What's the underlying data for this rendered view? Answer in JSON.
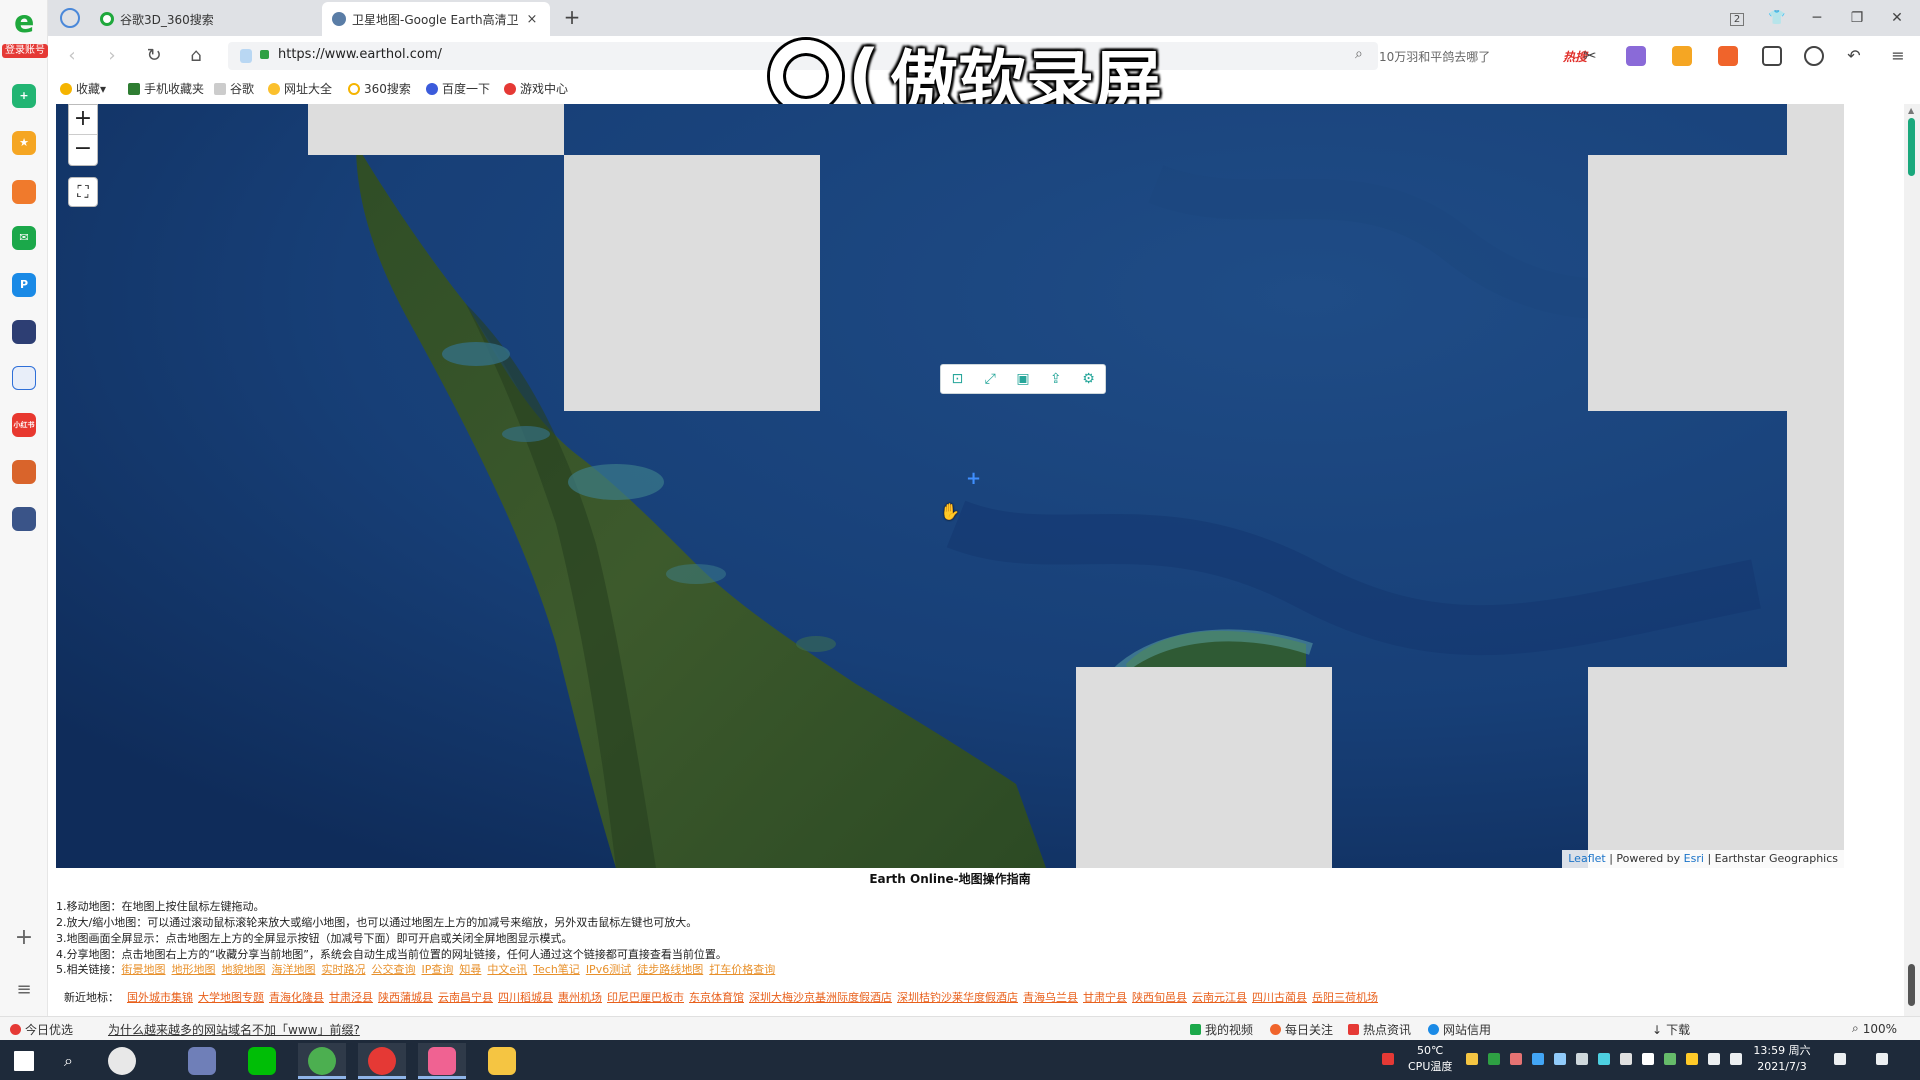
{
  "tabs": [
    {
      "title": "谷歌3D_360搜索"
    },
    {
      "title": "卫星地图-Google Earth高清卫"
    }
  ],
  "tab_close": "×",
  "new_tab": "+",
  "window": {
    "badge": "2"
  },
  "nav": {
    "back": "‹",
    "forward": "›",
    "reload": "↻",
    "home": "⌂"
  },
  "address": {
    "url": "https://www.earthol.com/"
  },
  "search": {
    "query": "10万羽和平鸽去哪了",
    "hot": "热搜"
  },
  "bookmarks": [
    "收藏",
    "手机收藏夹",
    "谷歌",
    "网址大全",
    "360搜索",
    "百度一下",
    "游戏中心"
  ],
  "watermark": {
    "text": "傲软录屏"
  },
  "sidebar": {
    "login_label": "登录账号",
    "items": [
      {
        "name": "plus",
        "color": "#22b573"
      },
      {
        "name": "star",
        "color": "#f5a623"
      },
      {
        "name": "weibo",
        "color": "#f07a2c"
      },
      {
        "name": "mail",
        "color": "#1ba84a"
      },
      {
        "name": "p-app",
        "color": "#1a8ae6",
        "label": "P"
      },
      {
        "name": "news",
        "color": "#2d3e73"
      },
      {
        "name": "doc",
        "color": "#2e6fd8"
      },
      {
        "name": "red-app",
        "color": "#e8382f",
        "label": "小红书"
      },
      {
        "name": "game1",
        "color": "#d9642b"
      },
      {
        "name": "game2",
        "color": "#3a5488"
      }
    ]
  },
  "map": {
    "zoom_in": "+",
    "zoom_out": "−",
    "fullscreen": "⛶",
    "tools": [
      "⊡",
      "⤢",
      "▣",
      "⇪",
      "⚙"
    ],
    "attribution": {
      "leaflet": "Leaflet",
      "powered": "| Powered by",
      "esri": "Esri",
      "earthstar": "| Earthstar Geographics"
    }
  },
  "guide": {
    "title": "Earth Online-地图操作指南",
    "lines": [
      "1.移动地图：在地图上按住鼠标左键拖动。",
      "2.放大/缩小地图：可以通过滚动鼠标滚轮来放大或缩小地图，也可以通过地图左上方的加减号来缩放，另外双击鼠标左键也可放大。",
      "3.地图画面全屏显示：点击地图左上方的全屏显示按钮（加减号下面）即可开启或关闭全屏地图显示模式。",
      "4.分享地图：点击地图右上方的“收藏分享当前地图”，系统会自动生成当前位置的网址链接，任何人通过这个链接都可直接查看当前位置。"
    ],
    "related_label": "5.相关链接：",
    "related_links": [
      "街景地图",
      "地形地图",
      "地貌地图",
      "海洋地图",
      "实时路况",
      "公交查询",
      "IP查询",
      "知尋",
      "中文e讯",
      "Tech笔记",
      "IPv6测试",
      "徒步路线地图",
      "打车价格查询"
    ],
    "nearby_label": "新近地标：",
    "nearby_links": [
      "国外城市集锦",
      "大学地图专题",
      "青海化隆县",
      "甘肃泾县",
      "陕西蒲城县",
      "云南昌宁县",
      "四川稻城县",
      "惠州机场",
      "印尼巴厘巴板市",
      "东京体育馆",
      "深圳大梅沙京基洲际度假酒店",
      "深圳桔钓沙莱华度假酒店",
      "青海乌兰县",
      "甘肃宁县",
      "陕西旬邑县",
      "云南元江县",
      "四川古蔺县",
      "岳阳三荷机场"
    ]
  },
  "statusbar": {
    "left": [
      "今日优选",
      "为什么越来越多的网站域名不加「www」前缀?"
    ],
    "right": [
      "我的视频",
      "每日关注",
      "热点资讯",
      "网站信用",
      "下载",
      "100%"
    ]
  },
  "taskbar": {
    "temp": "50℃",
    "temp_label": "CPU温度",
    "time": "13:59 周六",
    "date": "2021/7/3"
  }
}
